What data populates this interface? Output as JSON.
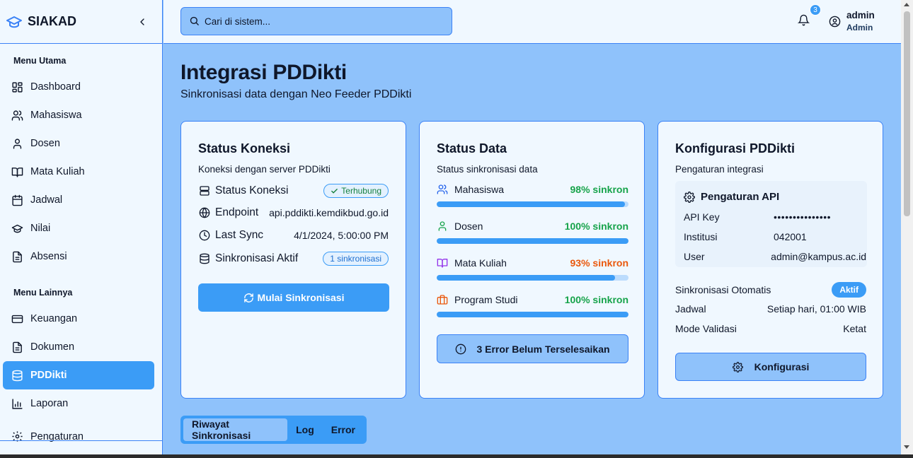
{
  "brand": {
    "name": "SIAKAD",
    "icon": "graduation-cap-icon"
  },
  "sidebar": {
    "section_main": "Menu Utama",
    "main_items": [
      {
        "label": "Dashboard",
        "icon": "dashboard-icon"
      },
      {
        "label": "Mahasiswa",
        "icon": "users-icon"
      },
      {
        "label": "Dosen",
        "icon": "user-icon"
      },
      {
        "label": "Mata Kuliah",
        "icon": "book-icon"
      },
      {
        "label": "Jadwal",
        "icon": "calendar-icon"
      },
      {
        "label": "Nilai",
        "icon": "graduation-cap-icon"
      },
      {
        "label": "Absensi",
        "icon": "clipboard-icon"
      }
    ],
    "section_other": "Menu Lainnya",
    "other_items": [
      {
        "label": "Keuangan",
        "icon": "credit-card-icon"
      },
      {
        "label": "Dokumen",
        "icon": "file-icon"
      },
      {
        "label": "PDDikti",
        "icon": "database-icon",
        "active": true
      },
      {
        "label": "Laporan",
        "icon": "bar-chart-icon"
      },
      {
        "label": "Pengaturan",
        "icon": "gear-icon"
      }
    ]
  },
  "header": {
    "search_placeholder": "Cari di sistem...",
    "notification_count": "3",
    "user_name": "admin",
    "user_role": "Admin"
  },
  "page": {
    "title": "Integrasi PDDikti",
    "subtitle": "Sinkronisasi data dengan Neo Feeder PDDikti"
  },
  "connection": {
    "title": "Status Koneksi",
    "description": "Koneksi dengan server PDDikti",
    "status_label": "Status Koneksi",
    "status_value": "Terhubung",
    "endpoint_label": "Endpoint",
    "endpoint_value": "api.pddikti.kemdikbud.go.id",
    "last_sync_label": "Last Sync",
    "last_sync_value": "4/1/2024, 5:00:00 PM",
    "active_sync_label": "Sinkronisasi Aktif",
    "active_sync_value": "1 sinkronisasi",
    "start_button": "Mulai Sinkronisasi"
  },
  "data_status": {
    "title": "Status Data",
    "description": "Status sinkronisasi data",
    "items": [
      {
        "label": "Mahasiswa",
        "percent_text": "98% sinkron",
        "percent": 98,
        "color": "#16a34a",
        "icon": "users-icon"
      },
      {
        "label": "Dosen",
        "percent_text": "100% sinkron",
        "percent": 100,
        "color": "#16a34a",
        "icon": "user-icon"
      },
      {
        "label": "Mata Kuliah",
        "percent_text": "93% sinkron",
        "percent": 93,
        "color": "#ea580c",
        "icon": "book-icon"
      },
      {
        "label": "Program Studi",
        "percent_text": "100% sinkron",
        "percent": 100,
        "color": "#16a34a",
        "icon": "briefcase-icon"
      }
    ],
    "error_button": "3 Error Belum Terselesaikan"
  },
  "config": {
    "title": "Konfigurasi PDDikti",
    "description": "Pengaturan integrasi",
    "api_title": "Pengaturan API",
    "api_key_label": "API Key",
    "api_key_value": "•••••••••••••••",
    "institution_label": "Institusi",
    "institution_value": "042001",
    "user_label": "User",
    "user_value": "admin@kampus.ac.id",
    "auto_sync_label": "Sinkronisasi Otomatis",
    "auto_sync_value": "Aktif",
    "schedule_label": "Jadwal",
    "schedule_value": "Setiap hari, 01:00 WIB",
    "validation_label": "Mode Validasi",
    "validation_value": "Ketat",
    "config_button": "Konfigurasi"
  },
  "tabs": [
    {
      "label": "Riwayat Sinkronisasi",
      "active": true
    },
    {
      "label": "Log"
    },
    {
      "label": "Error"
    }
  ],
  "colors": {
    "accent": "#3b9cf6",
    "background": "#8fc2fb",
    "surface": "#f0f8ff",
    "success": "#16a34a",
    "warning": "#ea580c"
  }
}
